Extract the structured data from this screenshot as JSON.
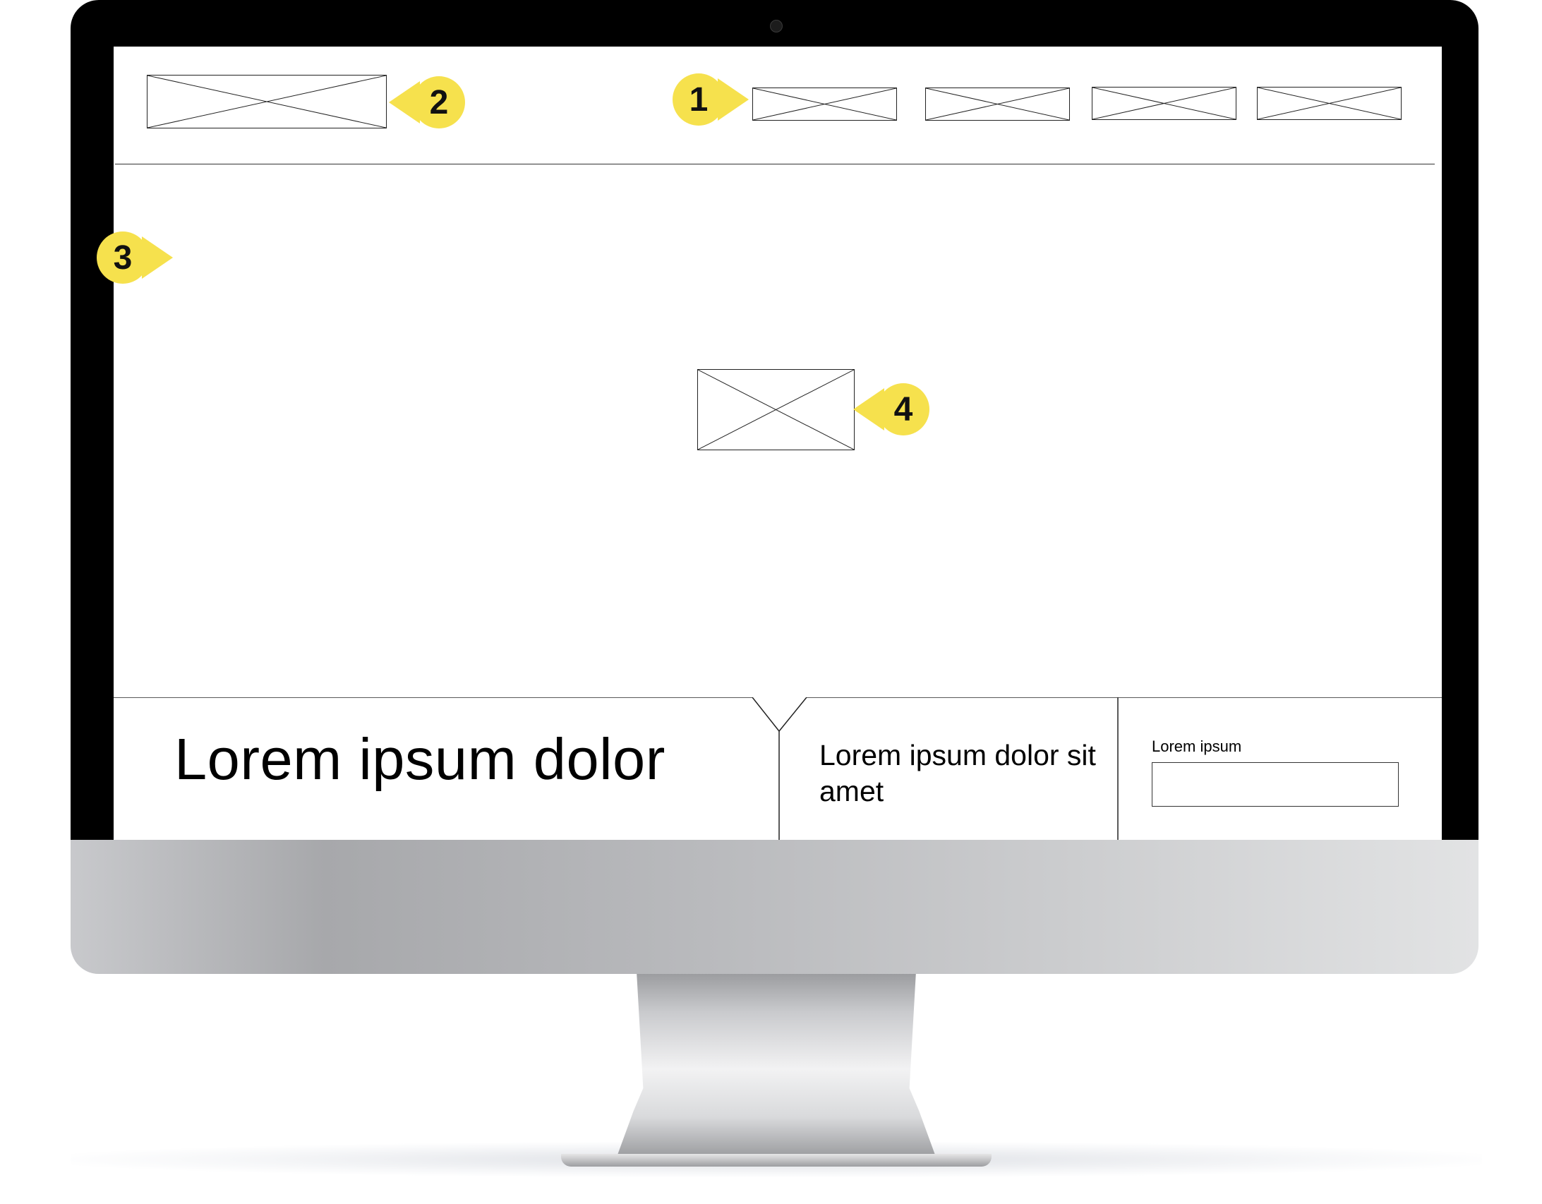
{
  "header": {
    "nav_item_count": 4
  },
  "callouts": {
    "nav_marker": "1",
    "logo_marker": "2",
    "hero_marker": "3",
    "image_marker": "4"
  },
  "hero": {
    "headline": "Lorem ipsum dolor",
    "subhead": "Lorem ipsum dolor sit amet"
  },
  "form": {
    "label": "Lorem ipsum",
    "input_value": ""
  },
  "colors": {
    "callout": "#f6e14d",
    "bezel": "#000000",
    "wireframe_line": "#222222"
  },
  "icons": {
    "placeholder": "image-placeholder-icon",
    "camera": "camera-icon"
  }
}
